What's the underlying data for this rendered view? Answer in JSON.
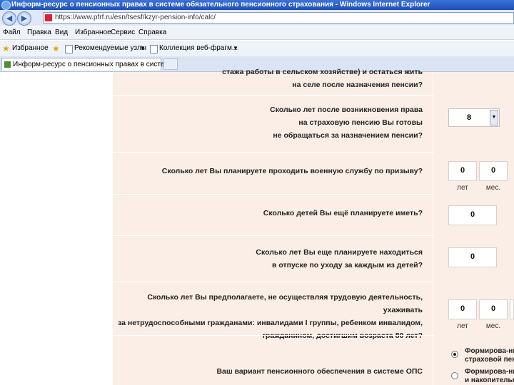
{
  "window": {
    "title": "Информ-ресурс о пенсионных правах в системе обязательного пенсионного страхования - Windows Internet Explorer",
    "url": "https://www.pfrf.ru/esn/tsesf/kzyr-pension-info/calc/"
  },
  "nav": {
    "back_icon": "back-arrow-icon",
    "forward_icon": "forward-arrow-icon"
  },
  "menu": [
    "Файл",
    "Правка",
    "Вид",
    "Избранное",
    "Сервис",
    "Справка"
  ],
  "favorites": {
    "label": "Избранное",
    "links": [
      "Рекомендуемые узлы",
      "Коллекция веб-фрагм..."
    ]
  },
  "tab": {
    "label": "Информ-ресурс о пенсионных правах в системе"
  },
  "questions": {
    "q0": {
      "line1": "стажа работы в сельском хозяйстве) и остаться жить",
      "line2": "на селе после назначения пенсии?"
    },
    "q1": {
      "line1": "Сколько лет после возникновения права",
      "line2": "на страховую пенсию Вы готовы",
      "line3": "не обращаться за назначением пенсии?",
      "value": "8"
    },
    "q2": {
      "text": "Сколько лет Вы планируете проходить военную службу по призыву?",
      "years": "0",
      "months": "0"
    },
    "q3": {
      "text": "Сколько детей Вы ещё планируете иметь?",
      "value": "0"
    },
    "q4": {
      "line1": "Сколько лет Вы еще планируете находиться",
      "line2": "в отпуске по уходу за каждым из детей?",
      "value": "0"
    },
    "q5": {
      "line1": "Сколько лет Вы предполагаете, не осуществляя трудовую деятельность, ухаживать",
      "line2": "за нетрудоспособными гражданами: инвалидами I группы, ребенком инвалидом,",
      "line3": "гражданином, достигшим возраста 80 лет?",
      "years": "0",
      "months": "0"
    },
    "q6": {
      "text": "Ваш вариант пенсионного обеспечения в системе ОПС"
    }
  },
  "units": {
    "years": "лет",
    "months": "мес."
  },
  "options": {
    "opt1": {
      "line1": "Формирова-ние",
      "line2": "страховой пенсии",
      "selected": true
    },
    "opt2": {
      "line1": "Формирова-ние",
      "line2": "и накопительной",
      "selected": false
    }
  }
}
